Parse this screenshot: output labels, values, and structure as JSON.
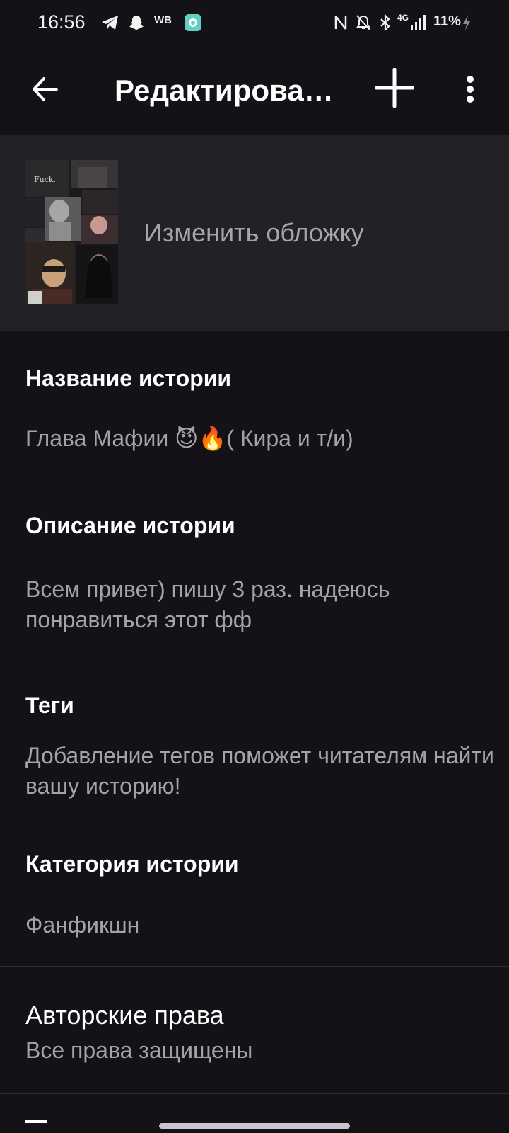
{
  "status_bar": {
    "time": "16:56",
    "network_label": "WB",
    "signal_label": "4G",
    "battery": "11%"
  },
  "app_bar": {
    "title": "Редактировать историю"
  },
  "cover": {
    "change_label": "Изменить обложку",
    "thumb_text": "Fuck."
  },
  "fields": {
    "title_label": "Название истории",
    "title_value": "Глава Мафии 😈🔥( Кира и т/и)",
    "description_label": "Описание истории",
    "description_value": "Всем привет) пишу 3 раз. надеюсь понравиться этот фф",
    "tags_label": "Теги",
    "tags_value": "Добавление тегов поможет читателям найти вашу историю!",
    "category_label": "Категория истории",
    "category_value": "Фанфикшн"
  },
  "copyright": {
    "title": "Авторские права",
    "value": "Все права защищены"
  },
  "colors": {
    "background": "#141216",
    "cover_section": "#222125",
    "text_primary": "#ffffff",
    "text_secondary": "#a5a3a8"
  }
}
